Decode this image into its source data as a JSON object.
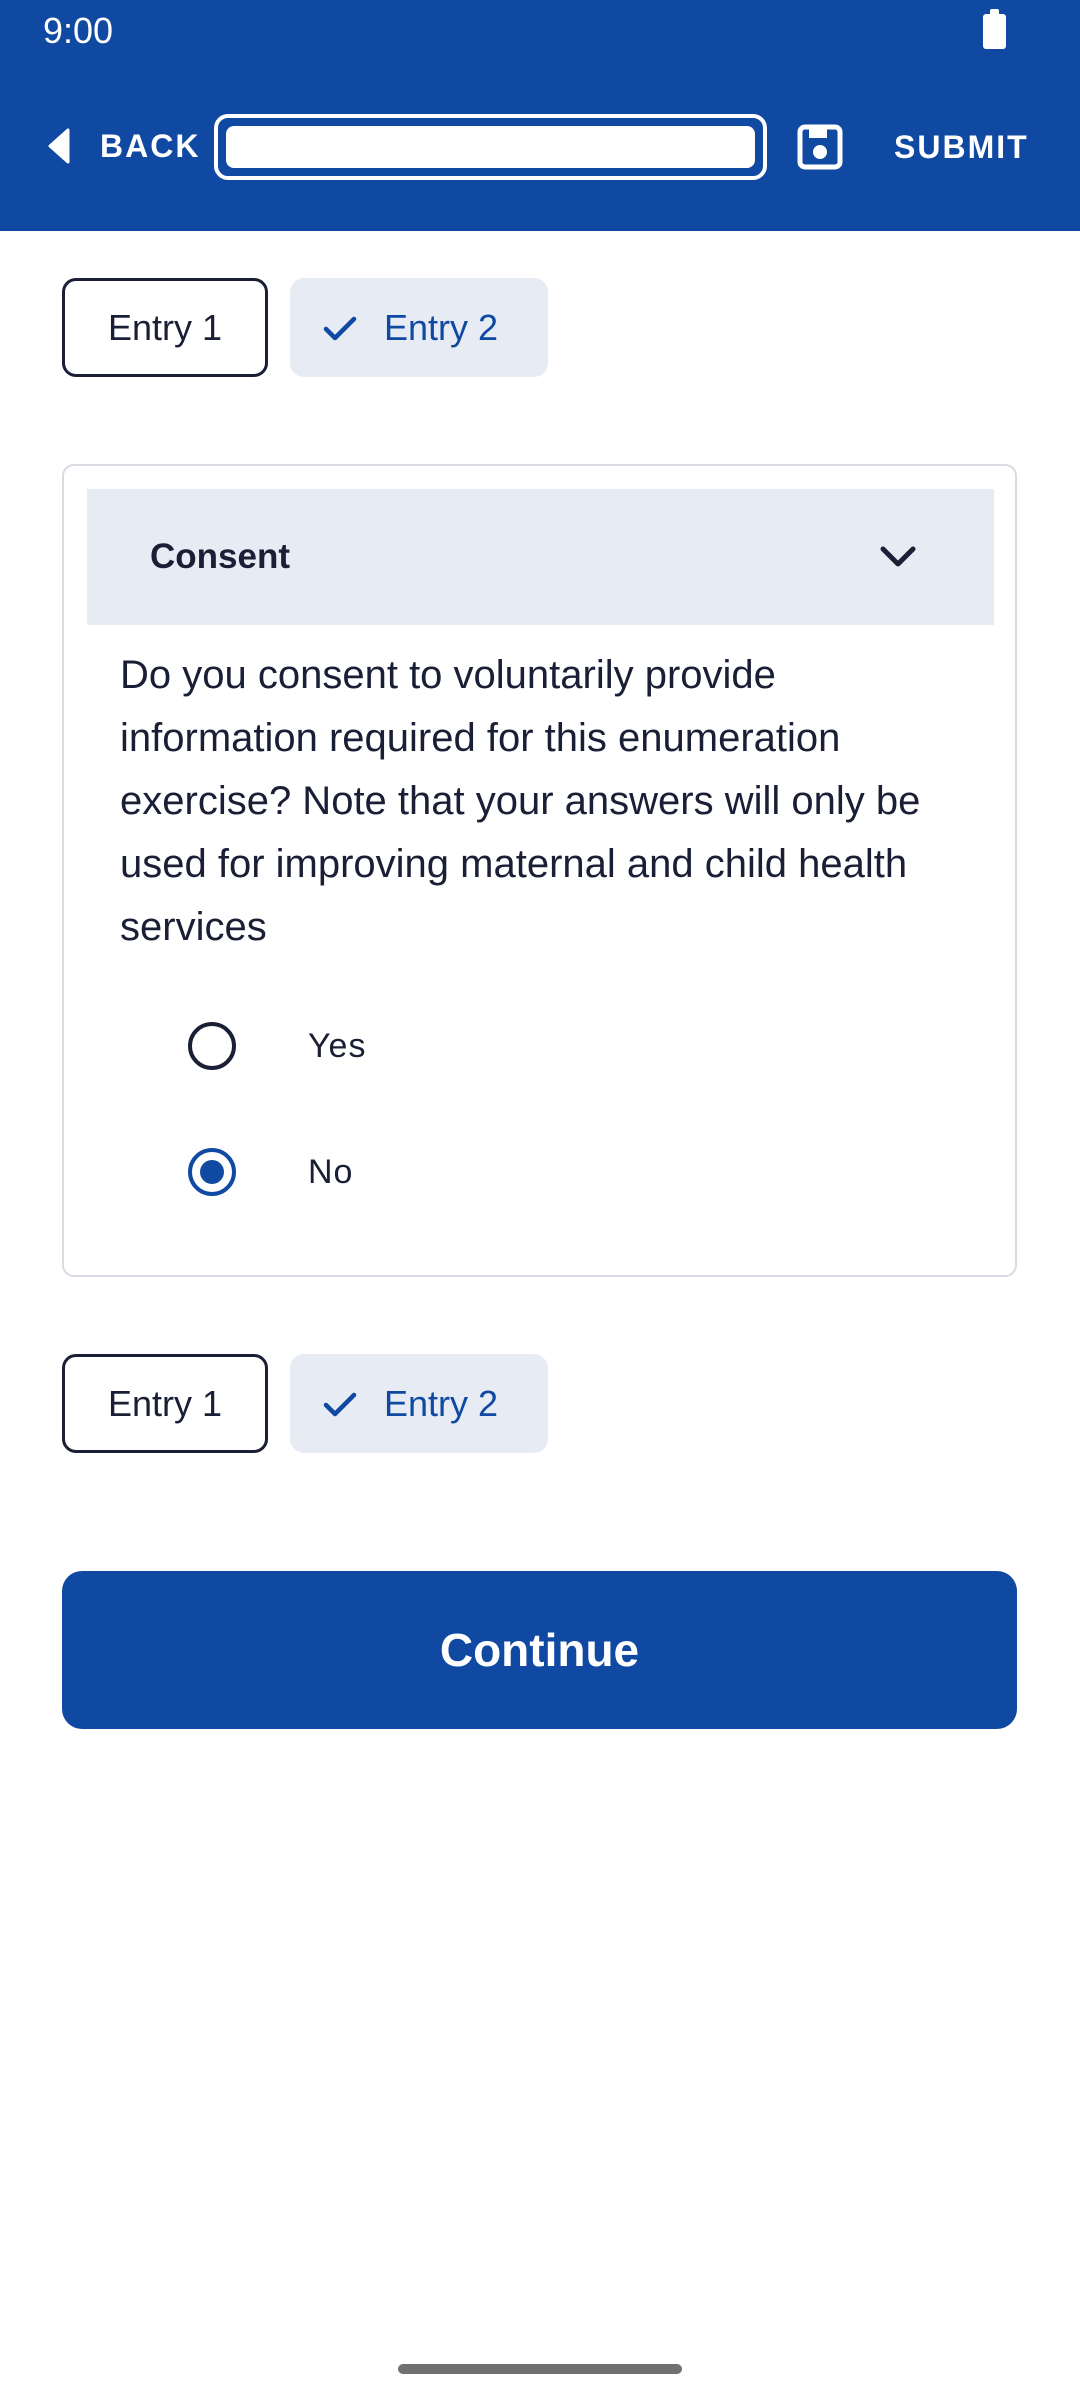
{
  "status_bar": {
    "time": "9:00",
    "battery_icon": "battery-full-icon"
  },
  "header": {
    "back_label": "BACK",
    "progress": 1.0,
    "save_icon": "save-icon",
    "submit_label": "SUBMIT"
  },
  "entries_top": [
    {
      "label": "Entry 1",
      "selected": false
    },
    {
      "label": "Entry 2",
      "selected": true
    }
  ],
  "section": {
    "title": "Consent",
    "question": "Do you consent to voluntarily provide information required for this enumeration exercise? Note that your answers will only be used for improving maternal and child health services",
    "options": [
      {
        "label": "Yes",
        "checked": false
      },
      {
        "label": "No",
        "checked": true
      }
    ]
  },
  "entries_bottom": [
    {
      "label": "Entry 1",
      "selected": false
    },
    {
      "label": "Entry 2",
      "selected": true
    }
  ],
  "continue_label": "Continue",
  "colors": {
    "primary": "#0f49a2",
    "chip_selected_bg": "#e7ebf3",
    "text_dark": "#1a1f36"
  }
}
